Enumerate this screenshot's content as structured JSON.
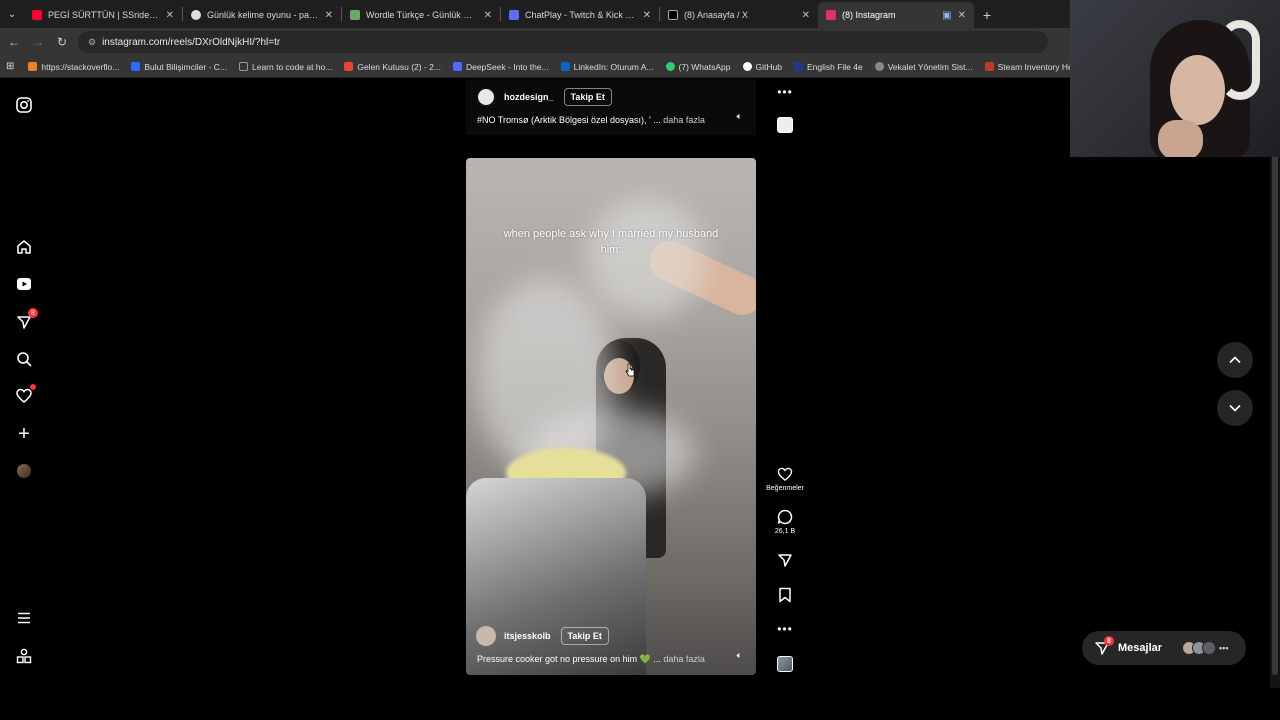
{
  "browser": {
    "tabs": [
      {
        "title": "PEGİ SÜRTTÜN | SSriders | Mot...",
        "favicon_color": "#ff0033",
        "active": false
      },
      {
        "title": "Günlük kelime oyunu - parolla",
        "favicon_color": "#e0e0e0",
        "active": false
      },
      {
        "title": "Wordle Türkçe - Günlük Kelime...",
        "favicon_color": "#6aaa64",
        "active": false
      },
      {
        "title": "ChatPlay - Twitch & Kick İzleyici...",
        "favicon_color": "#5b6cff",
        "active": false
      },
      {
        "title": "(8) Anasayfa / X",
        "favicon_color": "#000000",
        "active": false
      },
      {
        "title": "(8) Instagram",
        "favicon_color": "#e1306c",
        "active": true
      }
    ],
    "address": "instagram.com/reels/DXrOldNjkHI/?hl=tr",
    "bookmarks": [
      {
        "label": "https://stackoverflo...",
        "color": "#f48024"
      },
      {
        "label": "Bulut Bilişimciler - C...",
        "color": "#2b6cff"
      },
      {
        "label": "Learn to code at ho...",
        "color": "#333333"
      },
      {
        "label": "Gelen Kutusu (2) - 2...",
        "color": "#ea4335"
      },
      {
        "label": "DeepSeek - Into the...",
        "color": "#4d6bfe"
      },
      {
        "label": "LinkedIn: Oturum A...",
        "color": "#0a66c2"
      },
      {
        "label": "(7) WhatsApp",
        "color": "#25d366"
      },
      {
        "label": "GitHub",
        "color": "#ffffff"
      },
      {
        "label": "English File 4e",
        "color": "#1d3b8b"
      },
      {
        "label": "Vekalet Yönetim Sist...",
        "color": "#888888"
      },
      {
        "label": "Steam Inventory Hel...",
        "color": "#c0392b"
      }
    ]
  },
  "sidebar": {
    "notifications_badge": "8"
  },
  "reel_prev": {
    "username": "hozdesign_",
    "follow_label": "Takip Et",
    "description": "#NO Tromsø (Arktik Bölgesi özel dosyası), ' ...",
    "more_label": "daha fazla"
  },
  "reel": {
    "caption_line1": "when people ask why I married my husband",
    "caption_line2": "him:",
    "username": "itsjesskolb",
    "follow_label": "Takip Et",
    "description": "Pressure cooker got no pressure on him 💚 ...",
    "more_label": "daha fazla"
  },
  "actions": {
    "like_label": "Beğenmeler",
    "comment_count": "26,1 B"
  },
  "messages": {
    "label": "Mesajlar",
    "badge": "8"
  }
}
